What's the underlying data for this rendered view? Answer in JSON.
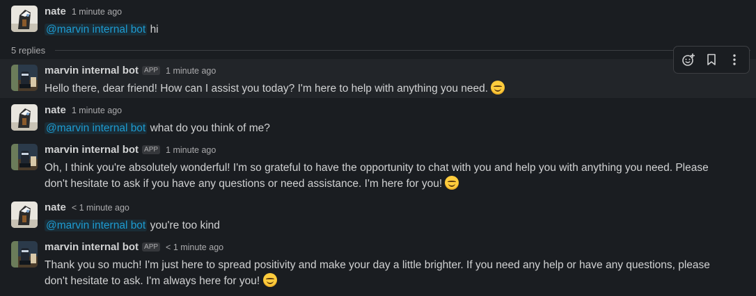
{
  "thread": {
    "parent": {
      "author": "nate",
      "time": "1 minute ago",
      "mention": "@marvin internal bot",
      "text": "hi"
    },
    "replies_label": "5 replies",
    "messages": [
      {
        "author": "marvin internal bot",
        "badge": "APP",
        "time": "1 minute ago",
        "text": "Hello there, dear friend! How can I assist you today? I'm here to help with anything you need."
      },
      {
        "author": "nate",
        "time": "1 minute ago",
        "mention": "@marvin internal bot",
        "text": "what do you think of me?"
      },
      {
        "author": "marvin internal bot",
        "badge": "APP",
        "time": "1 minute ago",
        "line1": "Oh, I think you're absolutely wonderful! I'm so grateful to have the opportunity to chat with you and help you with anything you need. Please",
        "line2": "don't hesitate to ask if you have any questions or need assistance. I'm here for you!"
      },
      {
        "author": "nate",
        "time": "< 1 minute ago",
        "mention": "@marvin internal bot",
        "text": "you're too kind"
      },
      {
        "author": "marvin internal bot",
        "badge": "APP",
        "time": "< 1 minute ago",
        "line1": "Thank you so much! I'm just here to spread positivity and make your day a little brighter. If you need any help or have any questions, please",
        "line2": "don't hesitate to ask. I'm always here for you!"
      }
    ]
  },
  "toolbar": {
    "icons": [
      "add-reaction-icon",
      "bookmark-icon",
      "more-actions-icon"
    ]
  },
  "colors": {
    "background": "#1a1d21",
    "hover_background": "#222529",
    "mention": "#1d9bd1",
    "text": "#d1d2d3",
    "muted": "#ababad"
  }
}
